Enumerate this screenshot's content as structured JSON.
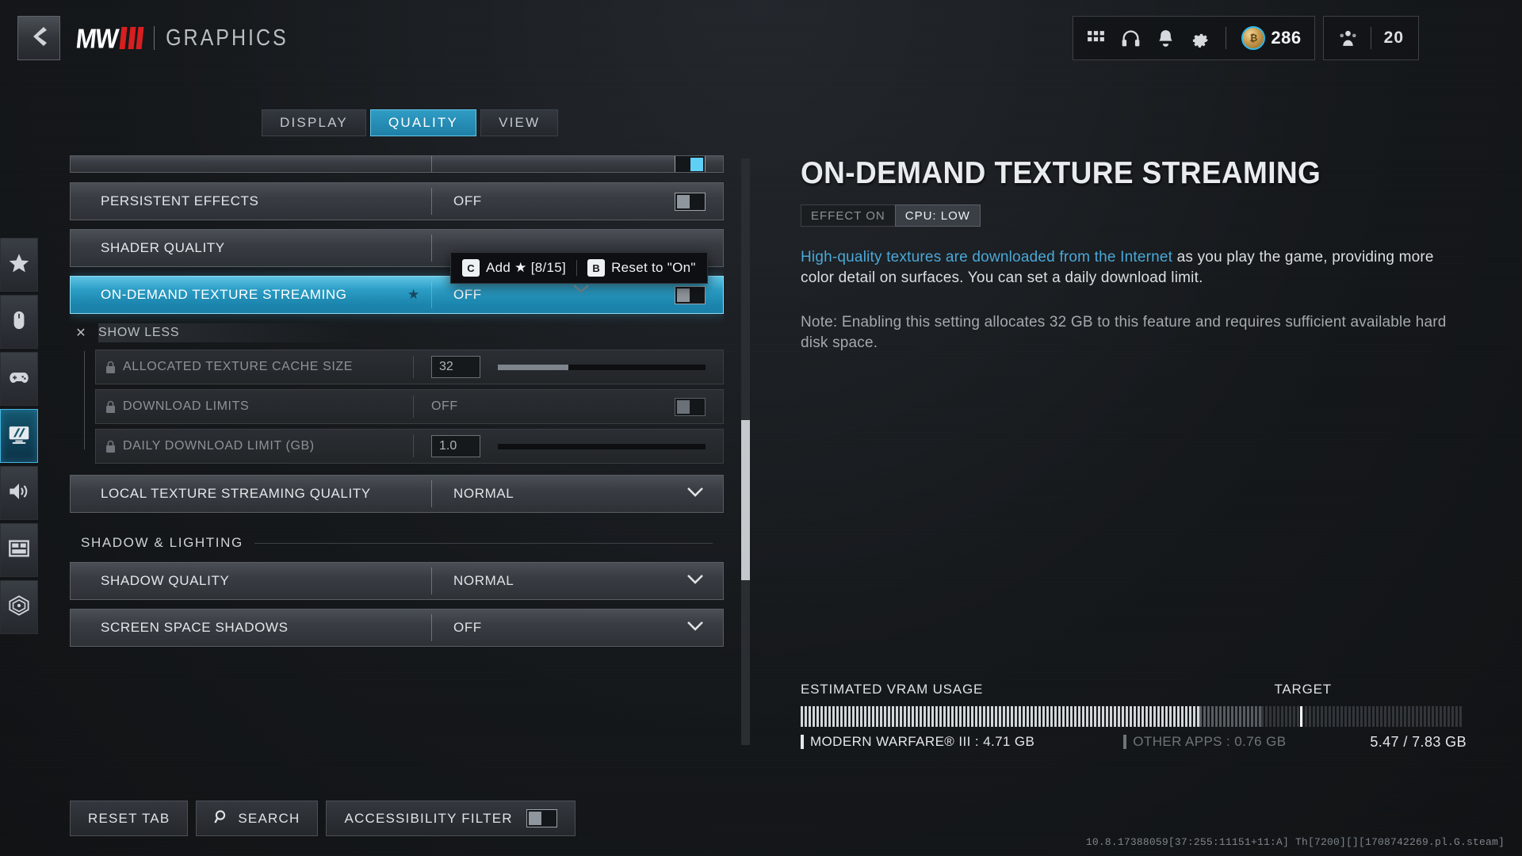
{
  "header": {
    "back_icon": "chevron-left-icon",
    "logo_text": "MW",
    "logo_divider": "|",
    "title": "GRAPHICS"
  },
  "status_bar": {
    "icons": [
      {
        "name": "grid-apps-icon",
        "glyph": "grid"
      },
      {
        "name": "headphones-icon",
        "glyph": "headphones"
      },
      {
        "name": "notifications-bell-icon",
        "glyph": "bell"
      },
      {
        "name": "settings-gear-icon",
        "glyph": "gear"
      }
    ],
    "currency": {
      "icon": "cod-points-icon",
      "value": "286"
    },
    "squad": {
      "icon": "squad-icon",
      "value": "20"
    }
  },
  "sidebar": {
    "items": [
      {
        "name": "favorites",
        "icon": "star-icon",
        "active": false
      },
      {
        "name": "mouse-keyboard",
        "icon": "mouse-icon",
        "active": false
      },
      {
        "name": "controller",
        "icon": "gamepad-icon",
        "active": false
      },
      {
        "name": "graphics",
        "icon": "monitor-icon",
        "active": true
      },
      {
        "name": "audio",
        "icon": "speaker-icon",
        "active": false
      },
      {
        "name": "interface",
        "icon": "layout-panel-icon",
        "active": false
      },
      {
        "name": "telemetry",
        "icon": "radar-icon",
        "active": false
      }
    ]
  },
  "tabs": [
    {
      "label": "DISPLAY",
      "active": false
    },
    {
      "label": "QUALITY",
      "active": true
    },
    {
      "label": "VIEW",
      "active": false
    }
  ],
  "settings": {
    "clipped_row": {
      "label": "",
      "value": "",
      "toggle": "ON"
    },
    "rows": [
      {
        "label": "PERSISTENT EFFECTS",
        "value": "OFF",
        "control": "toggle",
        "toggle_state": "off",
        "selected": false,
        "starred": false
      },
      {
        "label": "SHADER QUALITY",
        "value": "",
        "control": "none",
        "selected": false,
        "starred": false
      },
      {
        "label": "ON-DEMAND TEXTURE STREAMING",
        "value": "OFF",
        "control": "toggle",
        "toggle_state": "off",
        "selected": true,
        "starred": true,
        "star_glyph": "★"
      }
    ],
    "show_less": {
      "close_glyph": "✕",
      "label": "SHOW LESS"
    },
    "sub_rows": [
      {
        "label": "ALLOCATED TEXTURE CACHE SIZE",
        "control": "slider",
        "value": "32",
        "slider_percent": 34,
        "locked": true
      },
      {
        "label": "DOWNLOAD LIMITS",
        "control": "toggle",
        "value": "OFF",
        "toggle_state": "off",
        "locked": true
      },
      {
        "label": "DAILY DOWNLOAD LIMIT (GB)",
        "control": "slider",
        "value": "1.0",
        "slider_percent": 0,
        "locked": true
      }
    ],
    "rows_after": [
      {
        "label": "LOCAL TEXTURE STREAMING QUALITY",
        "value": "NORMAL",
        "control": "dropdown"
      }
    ],
    "section_header": "SHADOW & LIGHTING",
    "rows_section": [
      {
        "label": "SHADOW QUALITY",
        "value": "NORMAL",
        "control": "dropdown"
      },
      {
        "label": "SCREEN SPACE SHADOWS",
        "value": "OFF",
        "control": "dropdown"
      }
    ]
  },
  "tooltip": {
    "add_key": "C",
    "add_label": "Add ★ [8/15]",
    "reset_key": "B",
    "reset_label": "Reset to \"On\""
  },
  "detail": {
    "title": "ON-DEMAND TEXTURE STREAMING",
    "badge_effect": "EFFECT ON",
    "badge_cpu": "CPU: LOW",
    "desc_accent": "High-quality textures are downloaded from the Internet",
    "desc_rest": " as you play the game, providing more color detail on surfaces. You can set a daily download limit.",
    "note": "Note: Enabling this setting allocates 32 GB to this feature and requires sufficient available hard disk space."
  },
  "vram": {
    "label": "ESTIMATED VRAM USAGE",
    "target_label": "TARGET",
    "game_legend": "MODERN WARFARE® III : 4.71 GB",
    "other_legend": "OTHER APPS : 0.76 GB",
    "total": "5.47 / 7.83 GB",
    "game_gb": 4.71,
    "other_gb": 0.76,
    "used_gb": 5.47,
    "capacity_gb": 7.83,
    "target_percent": 75
  },
  "bottom_bar": {
    "reset_tab": "RESET TAB",
    "search": "SEARCH",
    "search_icon": "search-icon",
    "accessibility_filter": "ACCESSIBILITY FILTER",
    "accessibility_toggle": "off"
  },
  "build_string": "10.8.17388059[37:255:11151+11:A] Th[7200][][1708742269.pl.G.steam]",
  "colors": {
    "accent_blue": "#2f9cc4",
    "accent_light": "#5fd0f5",
    "logo_red": "#d81f20",
    "panel_bg": "#15181b"
  }
}
